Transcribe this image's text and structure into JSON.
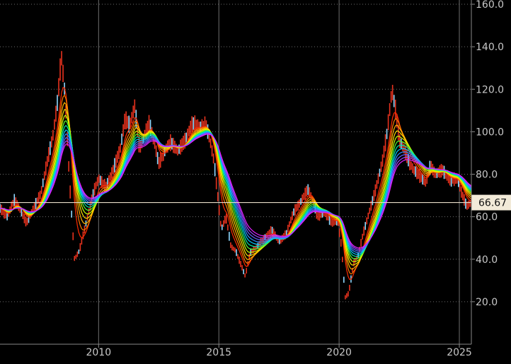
{
  "chart_data": {
    "type": "line",
    "title": "",
    "xlabel": "",
    "ylabel": "",
    "xlim": [
      2005.9,
      2025.5
    ],
    "ylim": [
      0,
      162
    ],
    "x_ticks": [
      2010,
      2015,
      2020,
      2025
    ],
    "x_tick_labels": [
      "2010",
      "2015",
      "2020",
      "2025"
    ],
    "y_ticks": [
      20,
      40,
      60,
      80,
      100,
      120,
      140,
      160
    ],
    "y_tick_labels": [
      "20.0",
      "40.0",
      "60.0",
      "80.0",
      "100.0",
      "120.0",
      "140.0",
      "160.0"
    ],
    "last_price": 66.67,
    "last_price_label": "66.67",
    "grid": true,
    "legend": "none",
    "colors": {
      "background": "#000000",
      "grid": "#6e6e6e",
      "axis_text": "#c8c8c8",
      "price_bar": "#e8321e",
      "price_bar_alt": "#8fd8ff",
      "last_price_line": "#e8dcc8",
      "last_price_box": "#f2ead8",
      "ribbon": [
        "#ff2a00",
        "#ff7a00",
        "#ffb000",
        "#ffe000",
        "#c8ff00",
        "#50ff30",
        "#00e8a0",
        "#00c8ff",
        "#3090ff",
        "#6060ff",
        "#a040ff",
        "#e020ff"
      ]
    },
    "price": {
      "x": [
        2005.9,
        2006.2,
        2006.5,
        2006.8,
        2007.0,
        2007.3,
        2007.6,
        2007.9,
        2008.1,
        2008.3,
        2008.45,
        2008.6,
        2008.8,
        2009.0,
        2009.2,
        2009.5,
        2009.8,
        2010.0,
        2010.3,
        2010.6,
        2010.9,
        2011.1,
        2011.3,
        2011.5,
        2011.7,
        2011.9,
        2012.1,
        2012.3,
        2012.5,
        2012.8,
        2013.0,
        2013.3,
        2013.6,
        2013.9,
        2014.2,
        2014.45,
        2014.6,
        2014.8,
        2014.95,
        2015.1,
        2015.3,
        2015.5,
        2015.7,
        2015.9,
        2016.1,
        2016.3,
        2016.6,
        2016.9,
        2017.2,
        2017.5,
        2017.8,
        2018.1,
        2018.4,
        2018.7,
        2018.9,
        2019.1,
        2019.4,
        2019.7,
        2019.95,
        2020.1,
        2020.25,
        2020.4,
        2020.6,
        2020.8,
        2021.0,
        2021.2,
        2021.5,
        2021.8,
        2022.0,
        2022.2,
        2022.35,
        2022.5,
        2022.7,
        2022.9,
        2023.1,
        2023.3,
        2023.6,
        2023.8,
        2024.0,
        2024.3,
        2024.6,
        2024.9,
        2025.1,
        2025.3,
        2025.5
      ],
      "y": [
        64,
        60,
        68,
        62,
        57,
        64,
        71,
        88,
        98,
        115,
        136,
        118,
        75,
        40,
        44,
        58,
        72,
        78,
        74,
        82,
        92,
        106,
        103,
        112,
        92,
        98,
        104,
        96,
        85,
        92,
        95,
        91,
        96,
        104,
        102,
        103,
        98,
        86,
        70,
        54,
        60,
        46,
        44,
        38,
        32,
        43,
        46,
        50,
        54,
        48,
        52,
        62,
        67,
        73,
        68,
        60,
        62,
        57,
        58,
        46,
        22,
        24,
        38,
        42,
        52,
        60,
        72,
        86,
        100,
        120,
        110,
        96,
        92,
        86,
        82,
        80,
        76,
        84,
        80,
        82,
        77,
        78,
        71,
        65,
        66.67
      ]
    },
    "ribbon_periods": [
      3,
      4,
      5,
      6,
      7,
      8,
      9,
      10,
      11,
      12,
      13,
      14
    ]
  }
}
